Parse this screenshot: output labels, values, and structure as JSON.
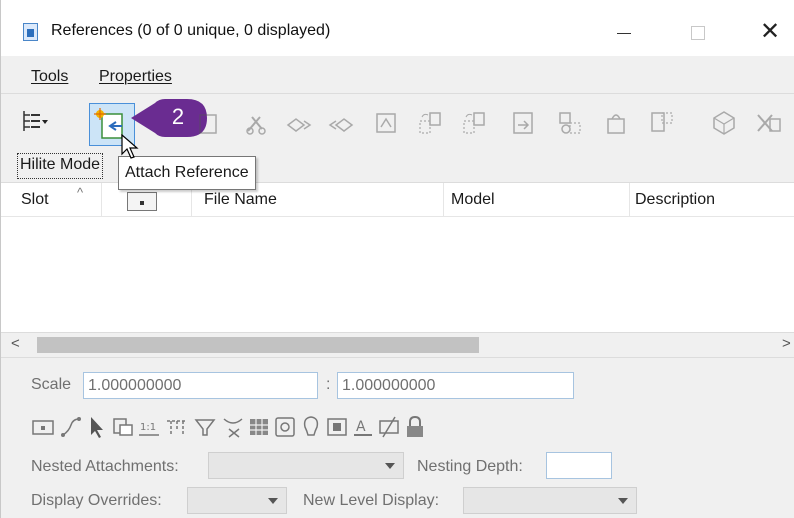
{
  "window": {
    "title": "References (0 of 0 unique, 0 displayed)",
    "minimize_icon": "minimize-icon",
    "maximize_icon": "maximize-icon",
    "close_icon": "close-icon"
  },
  "menu": {
    "items": [
      {
        "label": "Tools"
      },
      {
        "label": "Properties"
      }
    ]
  },
  "toolbar": {
    "callout_number": "2",
    "callout_color": "#6a2c91",
    "tooltip": "Attach Reference",
    "icons": [
      "tree-list-icon",
      "attach-reference-icon",
      "detach-icon",
      "reload-icon",
      "exchange-icon",
      "move-icon",
      "copy-icon",
      "scale-icon",
      "rotate-icon",
      "mirror-icon",
      "clip-boundary-icon",
      "clip-mask-icon",
      "delete-clip-icon",
      "3d-icon",
      "detach-all-icon"
    ]
  },
  "hilite_mode": "Hilite Mode",
  "table": {
    "columns": [
      "Slot",
      "File Name",
      "Model",
      "Description"
    ],
    "rows": []
  },
  "properties": {
    "scale_label": "Scale",
    "scale_value_1": "1.000000000",
    "scale_separator": ":",
    "scale_value_2": "1.000000000",
    "nested_attachments_label": "Nested Attachments:",
    "nested_attachments_value": "",
    "nesting_depth_label": "Nesting Depth:",
    "nesting_depth_value": "",
    "display_overrides_label": "Display Overrides:",
    "display_overrides_value": "",
    "new_level_display_label": "New Level Display:",
    "new_level_display_value": ""
  },
  "colors": {
    "accent": "#4a90d9",
    "callout": "#6a2c91"
  }
}
